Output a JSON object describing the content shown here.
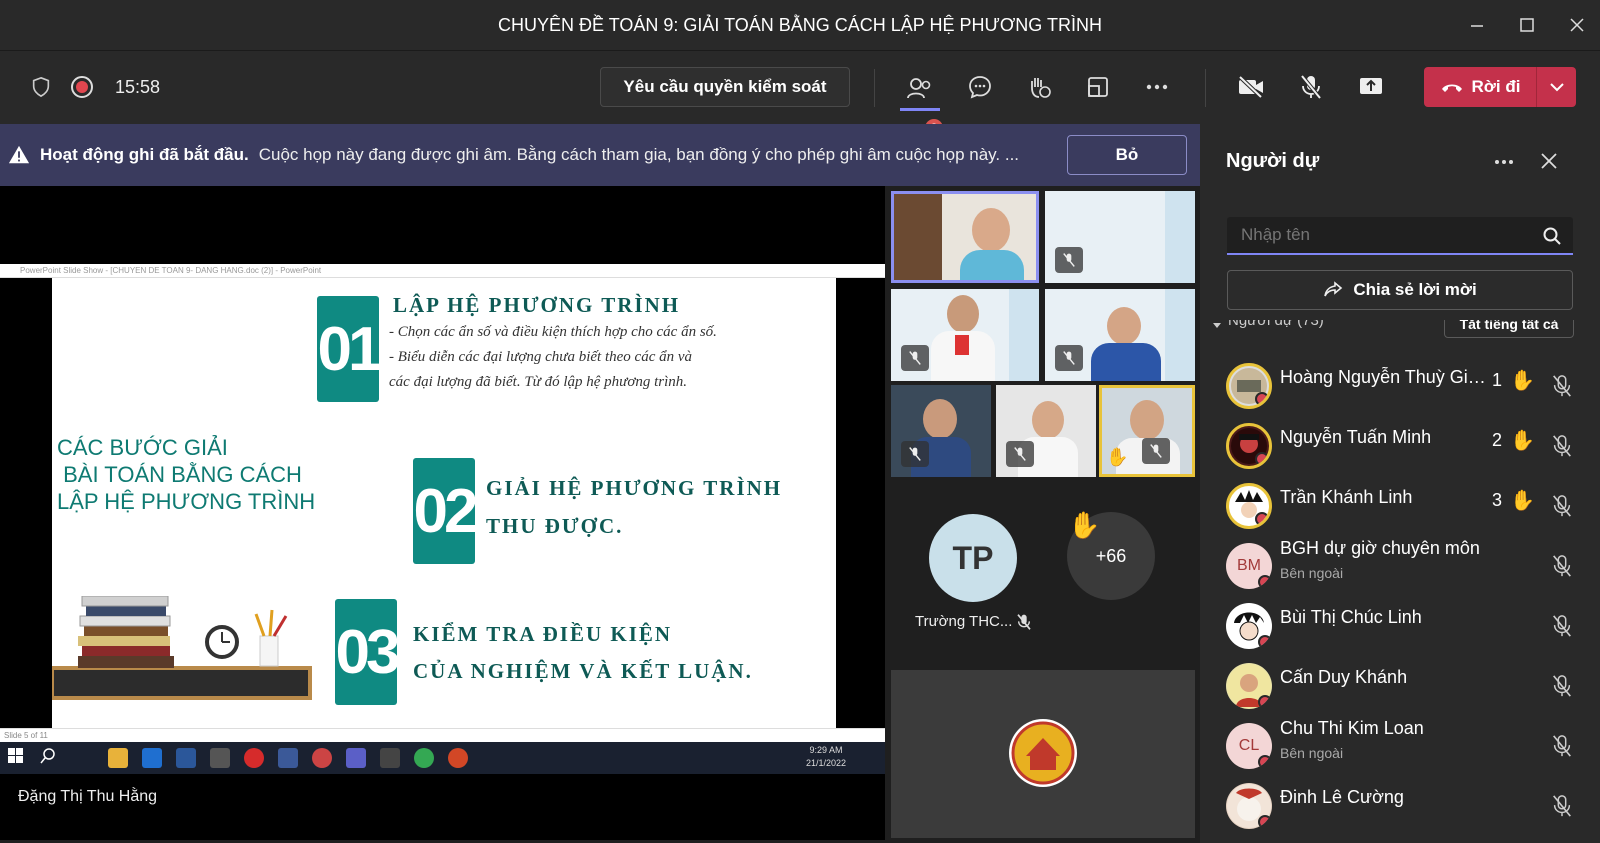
{
  "window": {
    "title": "CHUYÊN ĐỀ TOÁN 9: GIẢI TOÁN BẰNG CÁCH LẬP HỆ PHƯƠNG TRÌNH",
    "minimize_icon": "minimize-icon",
    "maximize_icon": "maximize-icon",
    "close_icon": "close-icon"
  },
  "toolbar": {
    "timer": "15:58",
    "control_button": "Yêu cầu quyền kiểm soát",
    "participants_badge": "3",
    "leave_label": "Rời đi",
    "accent": "#c4314b"
  },
  "banner": {
    "bold": "Hoạt động ghi đã bắt đầu.",
    "text": "Cuộc họp này đang được ghi âm. Bằng cách tham gia, bạn đồng ý cho phép ghi âm cuộc họp này. ...",
    "dismiss": "Bỏ"
  },
  "screenshare": {
    "window_title": "PowerPoint Slide Show - [CHUYEN DE TOAN 9- DANG HANG.doc (2)] - PowerPoint",
    "status": "Slide 5 of 11",
    "clock_time": "9:29 AM",
    "clock_date": "21/1/2022",
    "presenter": "Đặng Thị Thu Hằng"
  },
  "slide": {
    "heading_lines": [
      "CÁC BƯỚC GIẢI",
      " BÀI TOÁN BẰNG CÁCH",
      "LẬP HỆ PHƯƠNG TRÌNH"
    ],
    "steps": [
      {
        "num": "01",
        "title": "LẬP HỆ PHƯƠNG TRÌNH",
        "lines": [
          "- Chọn các ẩn số và điều kiện thích hợp cho các ẩn số.",
          "- Biểu diễn các đại lượng chưa biết theo các ẩn và",
          "các đại lượng đã biết. Từ đó lập hệ phương trình."
        ]
      },
      {
        "num": "02",
        "title_lines": [
          "GIẢI HỆ PHƯƠNG TRÌNH",
          "THU ĐƯỢC."
        ]
      },
      {
        "num": "03",
        "title_lines": [
          "KIỂM TRA ĐIỀU KIỆN",
          "CỦA NGHIỆM VÀ KẾT LUẬN."
        ]
      }
    ]
  },
  "gallery": {
    "tp_initials": "TP",
    "tp_name": "Trường THC...",
    "overflow": "+66"
  },
  "panel": {
    "title": "Người dự",
    "search_placeholder": "Nhập tên",
    "share_invite": "Chia sẻ lời mời",
    "section_label": "Người dự (73)",
    "mute_all": "Tắt tiếng tất cả",
    "participants": [
      {
        "name": "Hoàng Nguyễn Thuỳ Gia...",
        "hand": "1",
        "avatar": "photo"
      },
      {
        "name": "Nguyễn Tuấn Minh",
        "hand": "2",
        "avatar": "photo"
      },
      {
        "name": "Trần Khánh Linh",
        "hand": "3",
        "avatar": "photo"
      },
      {
        "name": "BGH dự giờ chuyên môn",
        "sub": "Bên ngoài",
        "initials": "BM"
      },
      {
        "name": "Bùi Thị Chúc Linh",
        "avatar": "photo"
      },
      {
        "name": "Cấn Duy Khánh",
        "avatar": "photo"
      },
      {
        "name": "Chu Thi Kim Loan",
        "sub": "Bên ngoài",
        "initials": "CL"
      },
      {
        "name": "Đinh Lê Cường",
        "avatar": "photo"
      }
    ]
  }
}
